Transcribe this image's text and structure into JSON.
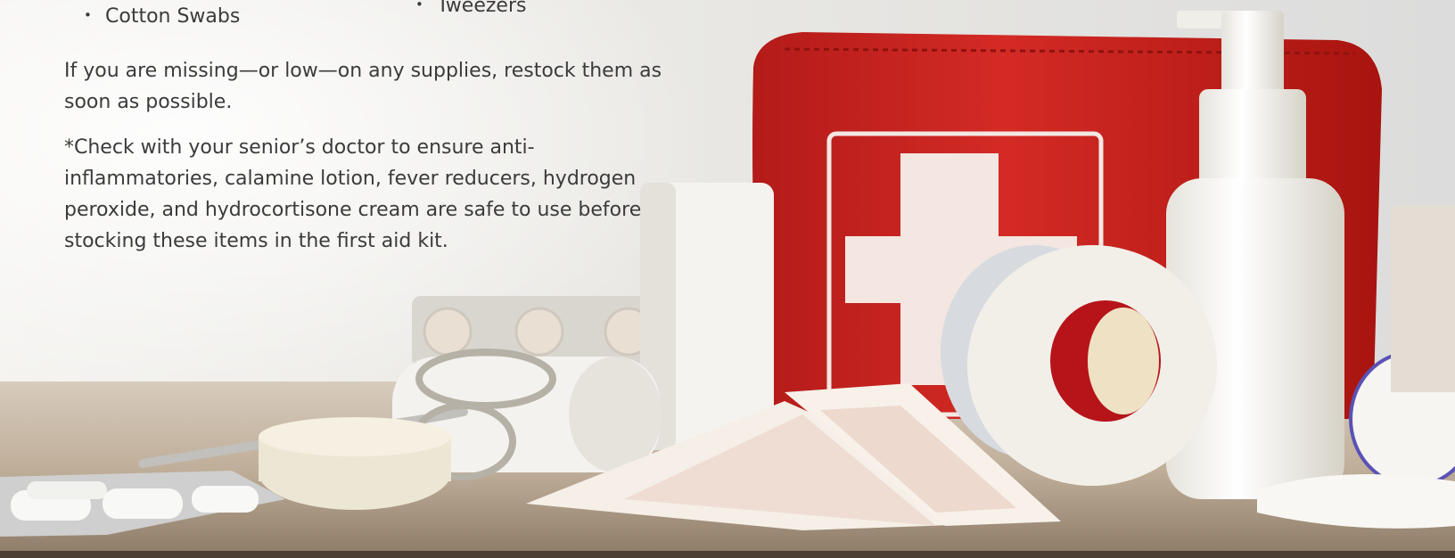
{
  "list": {
    "items": [
      "Cotton Swabs",
      "Tweezers"
    ]
  },
  "paragraphs": {
    "restock": "If you are missing—or low—on any supplies, restock them as soon as possible.",
    "note": "*Check with your senior’s doctor to ensure anti-inflammatories, calamine lotion, fever reducers, hydrogen peroxide, and hydrocortisone cream are safe to use before stocking these items in the first aid kit."
  },
  "colors": {
    "text": "#3b3b3b",
    "kit_red": "#c8211f",
    "table": "#b8a896"
  },
  "image": {
    "subject": "first-aid-kit-photo"
  }
}
